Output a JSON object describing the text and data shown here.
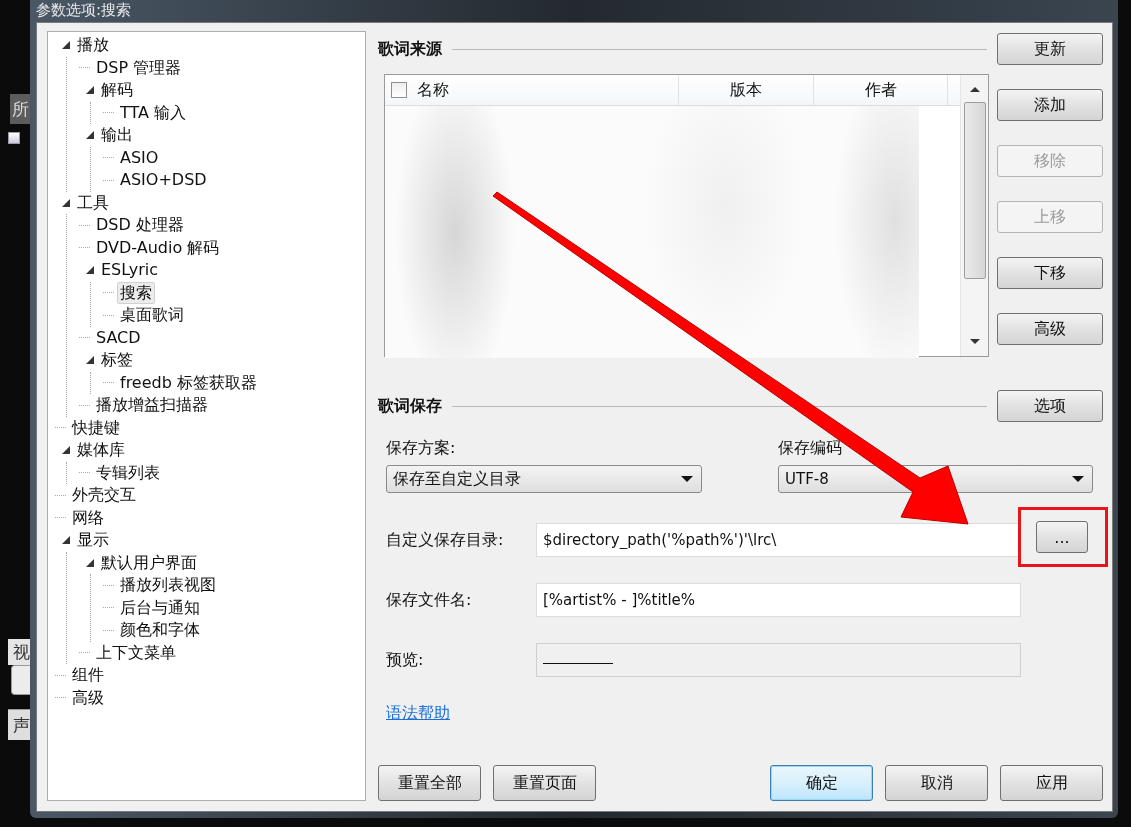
{
  "background_window": {
    "labels": [
      "所",
      "视",
      "声"
    ]
  },
  "window": {
    "title": "参数选项:搜索"
  },
  "tree": [
    {
      "label": "播放",
      "selected": false,
      "expanded": true,
      "children": [
        {
          "label": "DSP 管理器",
          "selected": false
        },
        {
          "label": "解码",
          "selected": false,
          "expanded": true,
          "children": [
            {
              "label": "TTA 输入",
              "selected": false
            }
          ]
        },
        {
          "label": "输出",
          "selected": false,
          "expanded": true,
          "children": [
            {
              "label": "ASIO",
              "selected": false
            },
            {
              "label": "ASIO+DSD",
              "selected": false
            }
          ]
        }
      ]
    },
    {
      "label": "工具",
      "selected": false,
      "expanded": true,
      "children": [
        {
          "label": "DSD 处理器",
          "selected": false
        },
        {
          "label": "DVD-Audio 解码",
          "selected": false
        },
        {
          "label": "ESLyric",
          "selected": false,
          "expanded": true,
          "children": [
            {
              "label": "搜索",
              "selected": true
            },
            {
              "label": "桌面歌词",
              "selected": false
            }
          ]
        },
        {
          "label": "SACD",
          "selected": false
        },
        {
          "label": "标签",
          "selected": false,
          "expanded": true,
          "children": [
            {
              "label": "freedb 标签获取器",
              "selected": false
            }
          ]
        },
        {
          "label": "播放增益扫描器",
          "selected": false
        }
      ]
    },
    {
      "label": "快捷键",
      "selected": false
    },
    {
      "label": "媒体库",
      "selected": false,
      "expanded": true,
      "children": [
        {
          "label": "专辑列表",
          "selected": false
        }
      ]
    },
    {
      "label": "外壳交互",
      "selected": false
    },
    {
      "label": "网络",
      "selected": false
    },
    {
      "label": "显示",
      "selected": false,
      "expanded": true,
      "children": [
        {
          "label": "默认用户界面",
          "selected": false,
          "expanded": true,
          "children": [
            {
              "label": "播放列表视图",
              "selected": false
            },
            {
              "label": "后台与通知",
              "selected": false
            },
            {
              "label": "颜色和字体",
              "selected": false
            }
          ]
        },
        {
          "label": "上下文菜单",
          "selected": false
        }
      ]
    },
    {
      "label": "组件",
      "selected": false
    },
    {
      "label": "高级",
      "selected": false
    }
  ],
  "sources": {
    "heading": "歌词来源",
    "select_all_checked": false,
    "columns": [
      "名称",
      "版本",
      "作者"
    ],
    "buttons": [
      {
        "label": "更新",
        "disabled": false
      },
      {
        "label": "添加",
        "disabled": false
      },
      {
        "label": "移除",
        "disabled": true
      },
      {
        "label": "上移",
        "disabled": true
      },
      {
        "label": "下移",
        "disabled": false
      },
      {
        "label": "高级",
        "disabled": false
      }
    ]
  },
  "save": {
    "heading": "歌词保存",
    "options_button": "选项",
    "scheme": {
      "label": "保存方案:",
      "value": "保存至自定义目录"
    },
    "encoding": {
      "label": "保存编码",
      "value": "UTF-8"
    },
    "directory": {
      "label": "自定义保存目录:",
      "value": "$directory_path('%path%')'\\lrc\\",
      "browse_button": "..."
    },
    "filename": {
      "label": "保存文件名:",
      "value": "[%artist% - ]%title%"
    },
    "preview": {
      "label": "预览:"
    },
    "help_link": "语法帮助"
  },
  "footer_buttons": [
    {
      "label": "重置全部",
      "default": false
    },
    {
      "label": "重置页面",
      "default": false
    },
    {
      "label": "确定",
      "default": true
    },
    {
      "label": "取消",
      "default": false
    },
    {
      "label": "应用",
      "default": false
    }
  ]
}
